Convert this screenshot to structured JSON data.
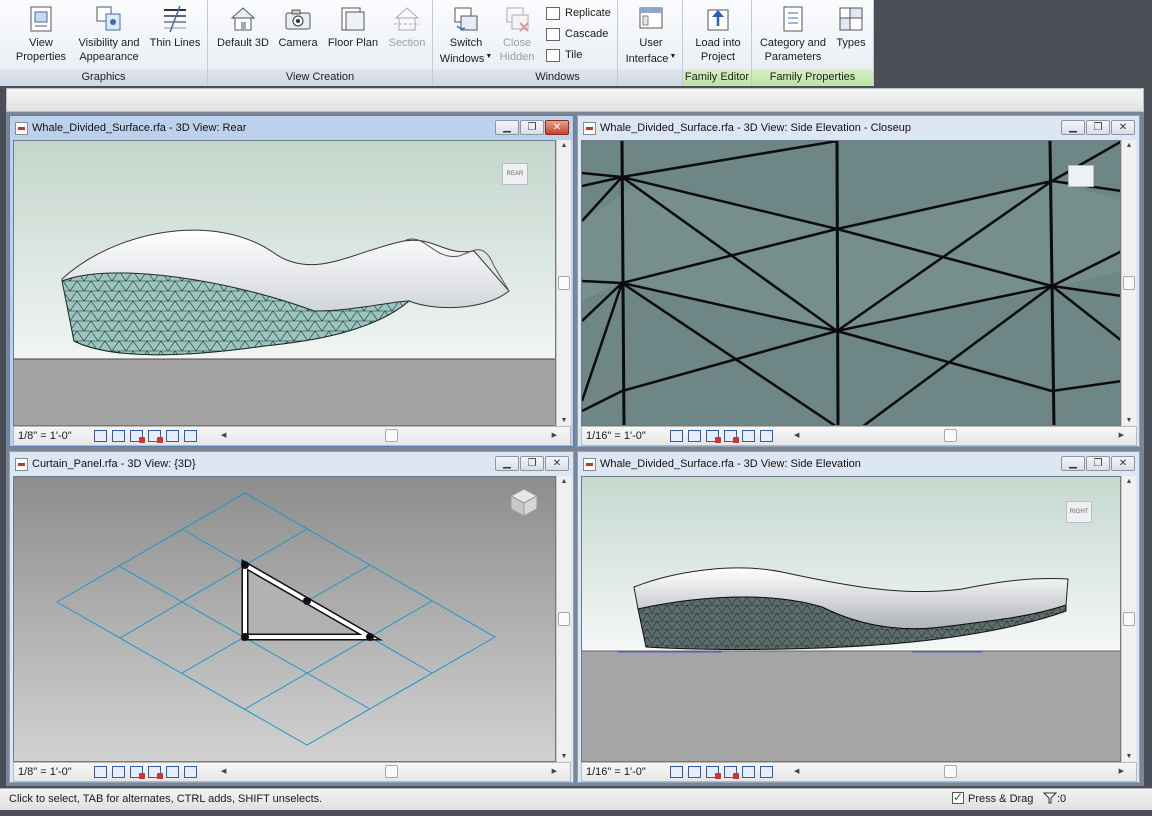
{
  "ribbon": {
    "panels": {
      "graphics": {
        "label": "Graphics",
        "view_properties": [
          "View",
          "Properties"
        ],
        "visibility": [
          "Visibility and",
          "Appearance"
        ],
        "thin_lines": "Thin Lines"
      },
      "view_creation": {
        "label": "View Creation",
        "default_3d": "Default 3D",
        "camera": "Camera",
        "floor_plan": "Floor Plan",
        "section": "Section"
      },
      "windows": {
        "label": "Windows",
        "switch_windows": [
          "Switch",
          "Windows"
        ],
        "close_hidden": [
          "Close",
          "Hidden"
        ],
        "replicate": "Replicate",
        "cascade": "Cascade",
        "tile": "Tile",
        "user_interface": [
          "User",
          "Interface"
        ]
      },
      "family_editor": {
        "label": "Family Editor",
        "load_into_project": [
          "Load into",
          "Project"
        ]
      },
      "family_properties": {
        "label": "Family Properties",
        "category_parameters": [
          "Category and",
          "Parameters"
        ],
        "types": "Types"
      }
    }
  },
  "windows": [
    {
      "title": "Whale_Divided_Surface.rfa - 3D View: Rear",
      "scale": "1/8\" = 1'-0\"",
      "active": true
    },
    {
      "title": "Whale_Divided_Surface.rfa - 3D View: Side Elevation - Closeup",
      "scale": "1/16\" = 1'-0\"",
      "active": false
    },
    {
      "title": "Curtain_Panel.rfa - 3D View: {3D}",
      "scale": "1/8\" = 1'-0\"",
      "active": false
    },
    {
      "title": "Whale_Divided_Surface.rfa - 3D View: Side Elevation",
      "scale": "1/16\" = 1'-0\"",
      "active": false
    }
  ],
  "navcube": {
    "rear": "REAR",
    "right": "RIGHT"
  },
  "statusbar": {
    "message": "Click to select, TAB for alternates, CTRL adds, SHIFT unselects.",
    "press_drag": "Press & Drag",
    "filter_count": ":0"
  },
  "icons": {
    "minimize": "minimize-icon",
    "restore": "restore-icon",
    "close": "close-icon"
  }
}
